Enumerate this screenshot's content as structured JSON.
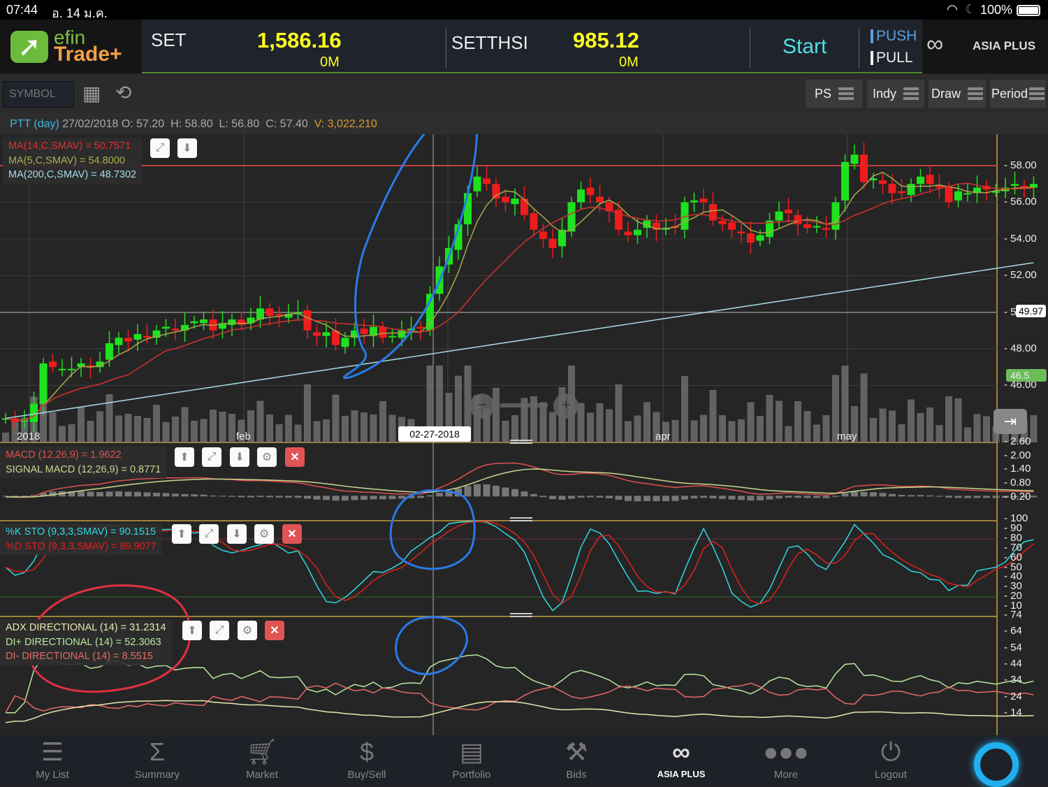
{
  "status": {
    "time": "07:44",
    "date": "อ. 14 ม.ค.",
    "battery": "100%"
  },
  "header": {
    "logo_top": "efin",
    "logo_bottom": "Trade+",
    "index1": {
      "name": "SET",
      "value": "1,586.16",
      "volume": "0M"
    },
    "index2": {
      "name": "SETTHSI",
      "value": "985.12",
      "volume": "0M"
    },
    "start": "Start",
    "push": "PUSH",
    "pull": "PULL",
    "broker": "ASIA PLUS"
  },
  "toolbar": {
    "symbol_placeholder": "SYMBOL",
    "buttons": [
      "PS",
      "Indy",
      "Draw",
      "Period"
    ]
  },
  "info": {
    "symbol": "PTT (day)",
    "date": "27/02/2018",
    "o_label": "O:",
    "o": "57.20",
    "h_label": "H:",
    "h": "58.80",
    "l_label": "L:",
    "l": "56.80",
    "c_label": "C:",
    "c": "57.40",
    "v_label": "V:",
    "v": "3,022,210"
  },
  "legend": {
    "ma14": "MA(14,C,SMAV) = 50.7571",
    "ma5": "MA(5,C,SMAV) = 54.8000",
    "ma200": "MA(200,C,SMAV) = 48.7302",
    "macd": "MACD (12,26,9) = 1.9622",
    "signal": "SIGNAL MACD (12,26,9) = 0.8771",
    "k": "%K STO (9,3,3,SMAV) = 90.1515",
    "d": "%D STO (9,3,3,SMAV) = 89.9077",
    "adx": "ADX DIRECTIONAL (14) = 31.2314",
    "dip": "DI+ DIRECTIONAL (14) = 52.3063",
    "dim": "DI- DIRECTIONAL (14) = 8.5515"
  },
  "axes": {
    "price": [
      "58.00",
      "56.00",
      "54.00",
      "52.00",
      "50",
      "48.00",
      "46.00"
    ],
    "macd": [
      "2.60",
      "2.00",
      "1.40",
      "0.80",
      "0.20"
    ],
    "sto": [
      "100",
      "90",
      "80",
      "70",
      "60",
      "50",
      "40",
      "30",
      "20",
      "10"
    ],
    "adx": [
      "74",
      "64",
      "54",
      "44",
      "34",
      "24",
      "14"
    ],
    "cursor_price": "49.97",
    "last_price": "46.5",
    "dates": [
      "2018",
      "feb",
      "apr",
      "may"
    ],
    "cursor_date": "02-27-2018"
  },
  "colors": {
    "up": "#1ee21e",
    "down": "#ee1c1c",
    "ma5": "#a8a84a",
    "ma14": "#d43030",
    "ma200": "#a8dce8"
  },
  "closes": [
    44.2,
    44.0,
    44.1,
    45.0,
    47.2,
    47.0,
    46.9,
    46.9,
    47.2,
    47.0,
    47.3,
    48.3,
    48.6,
    48.4,
    48.8,
    48.6,
    49.0,
    49.2,
    49.0,
    49.3,
    49.5,
    49.6,
    49.0,
    49.4,
    49.6,
    49.3,
    49.7,
    50.2,
    49.8,
    49.8,
    49.9,
    50.0,
    49.0,
    48.7,
    48.9,
    48.2,
    48.6,
    49.0,
    48.8,
    49.2,
    48.6,
    48.7,
    49.0,
    49.1,
    49.1,
    51.0,
    52.5,
    53.5,
    54.8,
    56.5,
    57.4,
    57.0,
    56.2,
    56.0,
    56.2,
    55.3,
    54.5,
    54.0,
    53.5,
    54.5,
    56.0,
    56.7,
    56.4,
    56.0,
    55.5,
    54.5,
    54.2,
    54.5,
    55.0,
    54.5,
    54.6,
    54.6,
    56.0,
    56.1,
    56.0,
    55.0,
    54.8,
    54.5,
    54.3,
    53.8,
    54.2,
    55.0,
    55.5,
    55.4,
    54.8,
    54.6,
    54.7,
    54.5,
    56.0,
    58.2,
    58.6,
    57.1,
    57.3,
    57.0,
    56.5,
    56.5,
    57.0,
    57.4,
    57.0,
    56.8,
    56.0,
    56.6,
    56.5,
    56.8,
    56.7,
    56.6,
    56.8,
    57.0,
    56.8,
    57.0
  ],
  "nav": [
    "My List",
    "Summary",
    "Market",
    "Buy/Sell",
    "Portfolio",
    "Bids",
    "ASIA PLUS",
    "More",
    "Logout"
  ]
}
